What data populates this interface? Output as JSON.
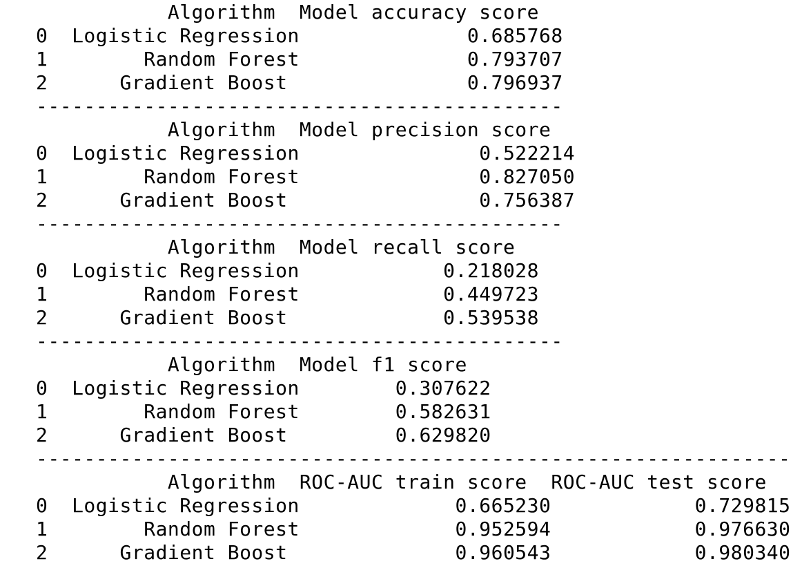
{
  "tables": [
    {
      "header": "           Algorithm  Model accuracy score",
      "rows": [
        "0  Logistic Regression              0.685768",
        "1        Random Forest              0.793707",
        "2      Gradient Boost               0.796937"
      ],
      "separator": "--------------------------------------------"
    },
    {
      "header": "           Algorithm  Model precision score",
      "rows": [
        "0  Logistic Regression               0.522214",
        "1        Random Forest               0.827050",
        "2      Gradient Boost                0.756387"
      ],
      "separator": "--------------------------------------------"
    },
    {
      "header": "           Algorithm  Model recall score",
      "rows": [
        "0  Logistic Regression            0.218028",
        "1        Random Forest            0.449723",
        "2      Gradient Boost             0.539538"
      ],
      "separator": "--------------------------------------------"
    },
    {
      "header": "           Algorithm  Model f1 score",
      "rows": [
        "0  Logistic Regression        0.307622",
        "1        Random Forest        0.582631",
        "2      Gradient Boost         0.629820"
      ],
      "separator": "---------------------------------------------------------------"
    },
    {
      "header": "           Algorithm  ROC-AUC train score  ROC-AUC test score",
      "rows": [
        "0  Logistic Regression             0.665230            0.729815",
        "1        Random Forest             0.952594            0.976630",
        "2      Gradient Boost              0.960543            0.980340"
      ]
    }
  ]
}
